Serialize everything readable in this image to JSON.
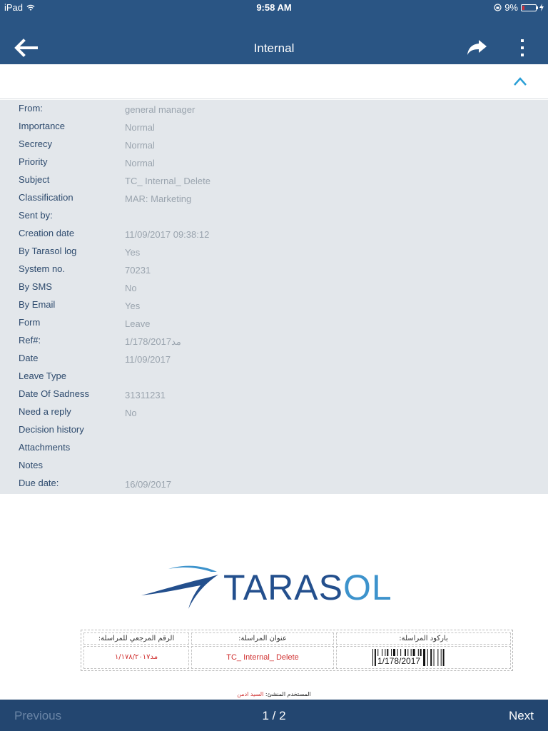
{
  "status_bar": {
    "device": "iPad",
    "time": "9:58 AM",
    "battery": "9%",
    "battery_level_percent": 9
  },
  "nav": {
    "title": "Internal",
    "back_icon": "arrow-left-icon",
    "share_icon": "forward-share-icon",
    "more_icon": "vertical-dots-icon"
  },
  "collapse_icon": "chevron-up-icon",
  "details": [
    {
      "label": "From:",
      "value": "general manager"
    },
    {
      "label": "Importance",
      "value": "Normal"
    },
    {
      "label": "Secrecy",
      "value": "Normal"
    },
    {
      "label": "Priority",
      "value": "Normal"
    },
    {
      "label": "Subject",
      "value": "TC_ Internal_ Delete"
    },
    {
      "label": "Classification",
      "value": "MAR: Marketing"
    },
    {
      "label": "Sent by:",
      "value": ""
    },
    {
      "label": "Creation date",
      "value": "11/09/2017 09:38:12"
    },
    {
      "label": "By Tarasol log",
      "value": "Yes"
    },
    {
      "label": "System no.",
      "value": "70231"
    },
    {
      "label": "By SMS",
      "value": "No"
    },
    {
      "label": "By Email",
      "value": "Yes"
    },
    {
      "label": "Form",
      "value": "Leave"
    },
    {
      "label": "Ref#:",
      "value": "1/178/2017مد"
    },
    {
      "label": "Date",
      "value": "11/09/2017"
    },
    {
      "label": "Leave Type",
      "value": ""
    },
    {
      "label": "Date Of Sadness",
      "value": "31311231"
    },
    {
      "label": "Need a reply",
      "value": "No"
    },
    {
      "label": "Decision history",
      "value": ""
    },
    {
      "label": "Attachments",
      "value": ""
    },
    {
      "label": "Notes",
      "value": ""
    },
    {
      "label": "Due date:",
      "value": "16/09/2017"
    }
  ],
  "document": {
    "logo_text_main": "TARAS",
    "logo_text_accent": "OL",
    "table": {
      "headers": [
        "باركود المراسلة:",
        "عنوان المراسلة:",
        "الرقم المرجعي للمراسلة:"
      ],
      "barcode_text": "1/178/2017",
      "subject": "TC_ Internal_ Delete",
      "ref_number": "مد١/١٧٨/٢٠١٧"
    },
    "footer_label": "المستخدم المنشئ:",
    "footer_name": "السيد ادمن"
  },
  "bottom_bar": {
    "previous": "Previous",
    "page": "1 / 2",
    "next": "Next"
  }
}
